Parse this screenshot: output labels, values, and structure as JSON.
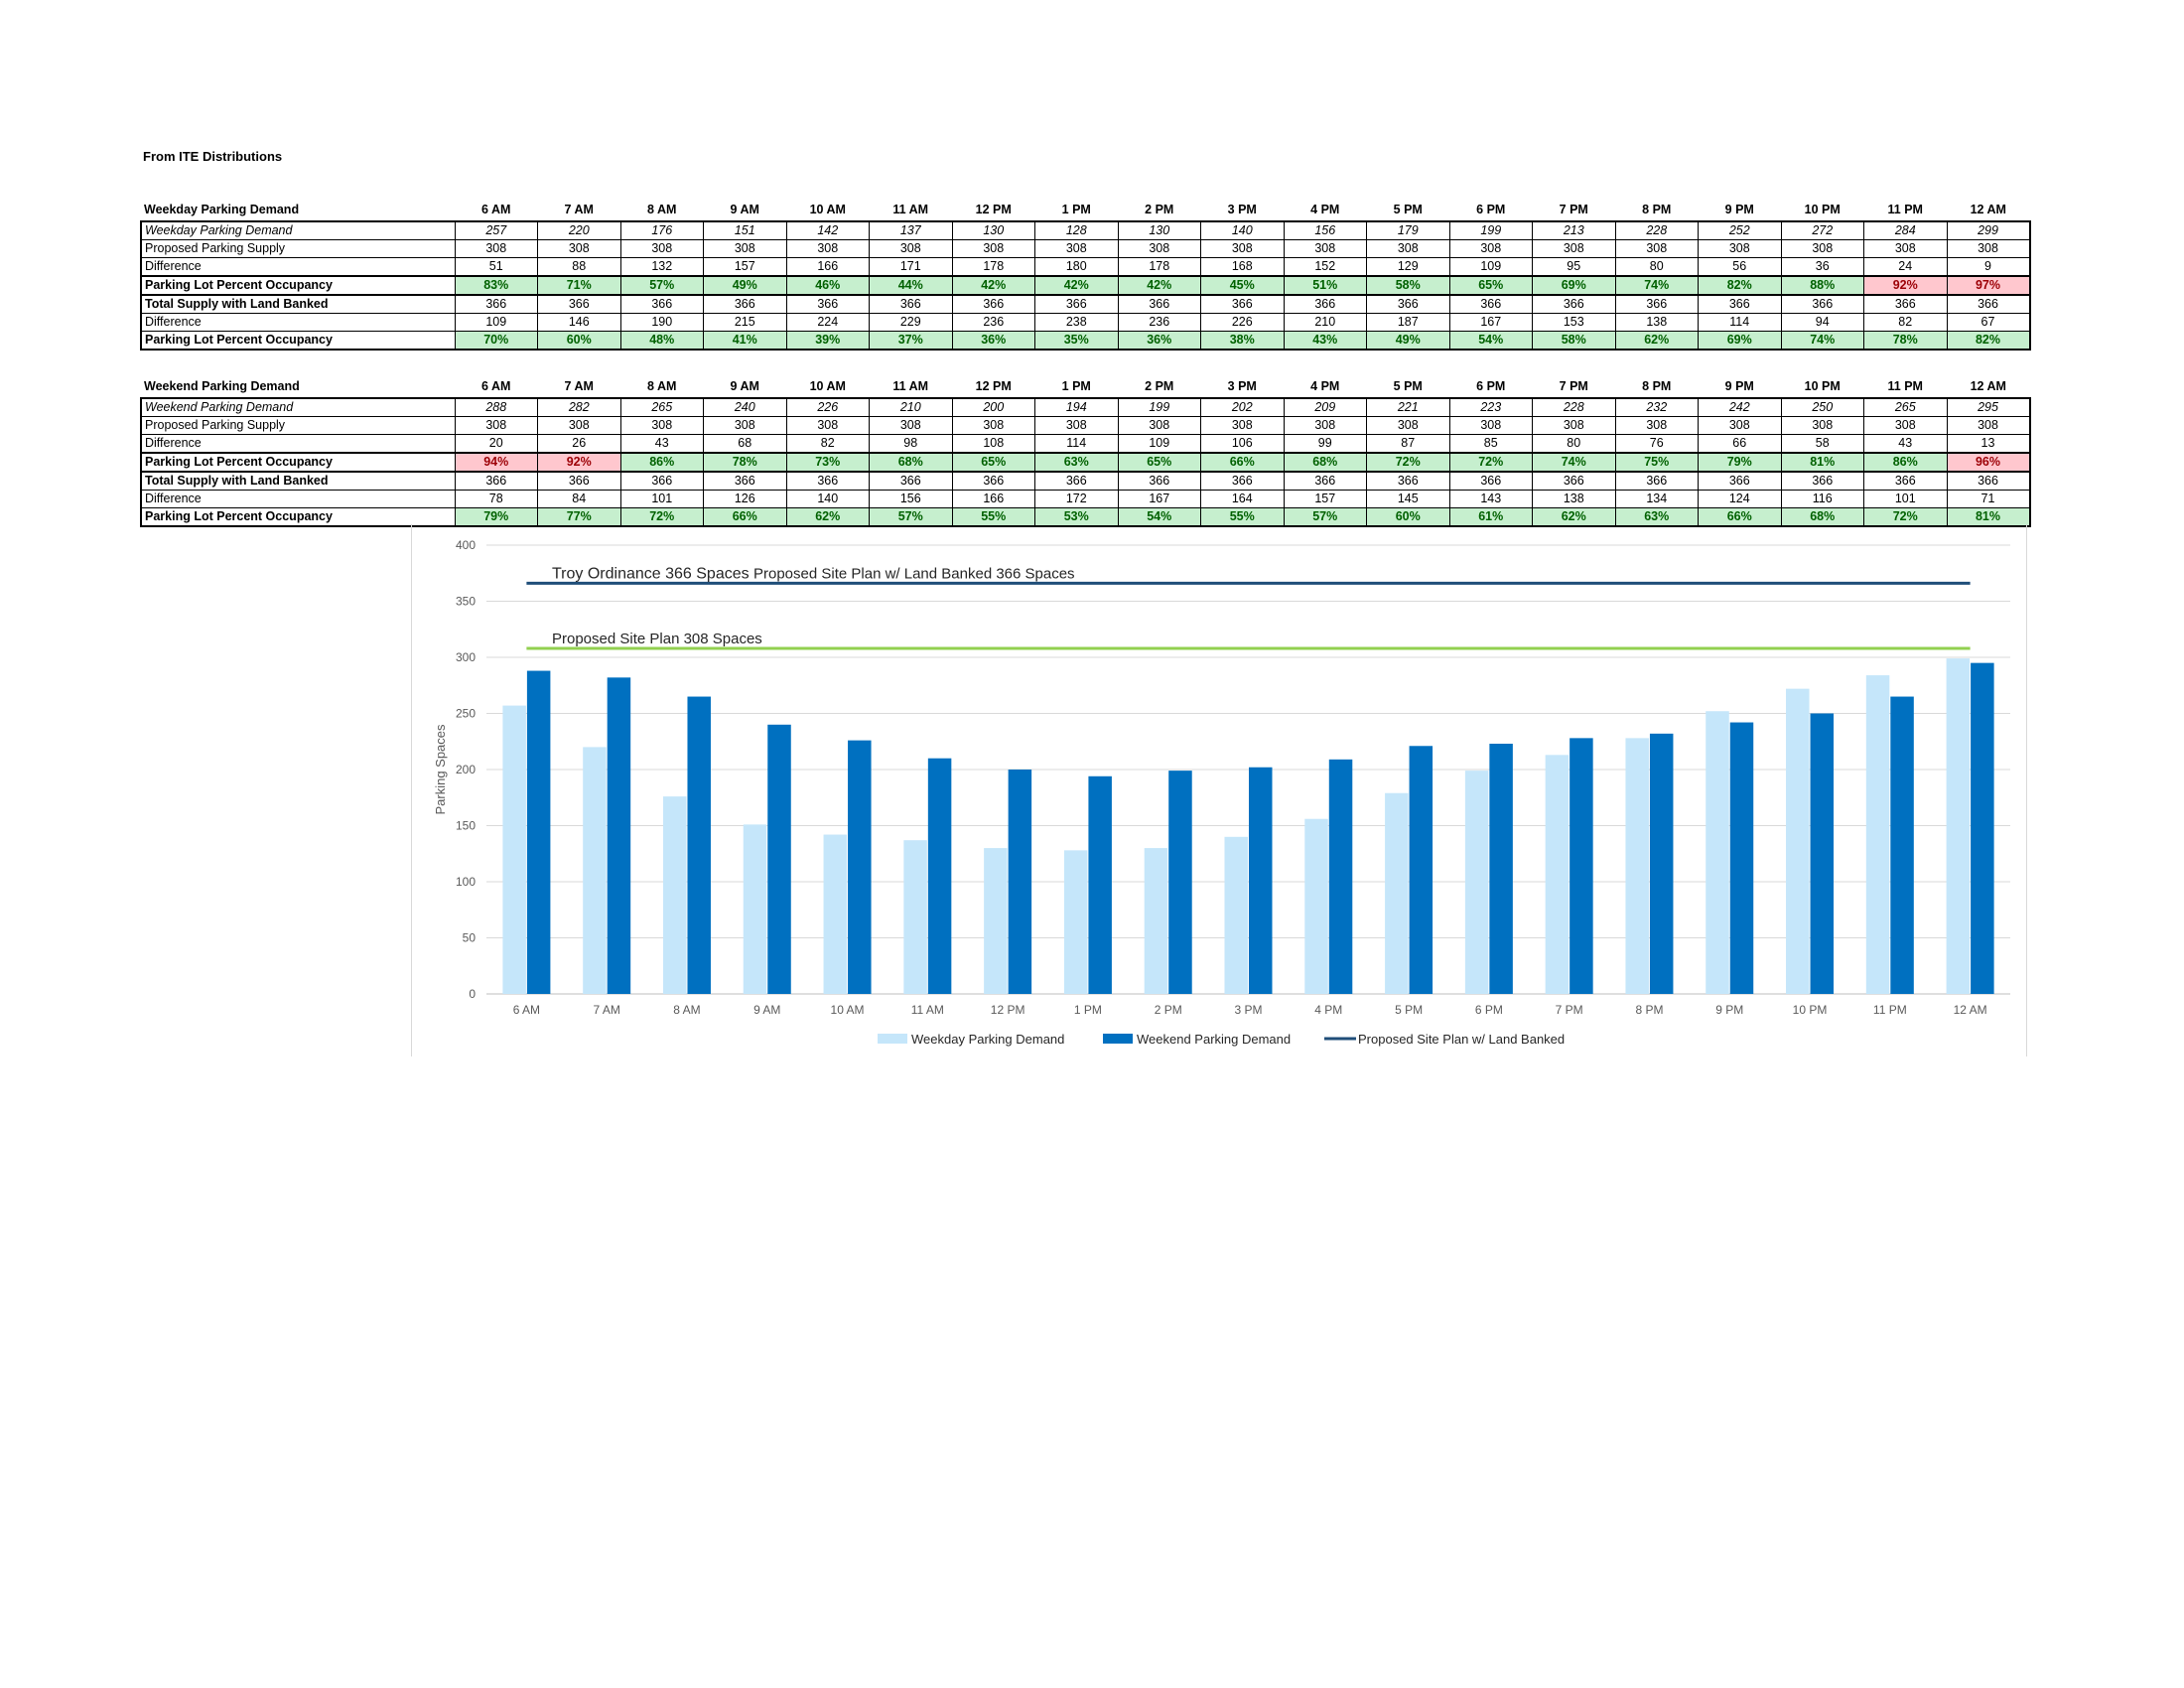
{
  "source_title": "From ITE Distributions",
  "tables": [
    {
      "header": "Weekday Parking Demand",
      "hours": [
        "6 AM",
        "7 AM",
        "8 AM",
        "9 AM",
        "10 AM",
        "11 AM",
        "12 PM",
        "1 PM",
        "2 PM",
        "3 PM",
        "4 PM",
        "5 PM",
        "6 PM",
        "7 PM",
        "8 PM",
        "9 PM",
        "10 PM",
        "11 PM",
        "12 AM"
      ],
      "rows": [
        {
          "label": "Weekday Parking Demand",
          "values": [
            "257",
            "220",
            "176",
            "151",
            "142",
            "137",
            "130",
            "128",
            "130",
            "140",
            "156",
            "179",
            "199",
            "213",
            "228",
            "252",
            "272",
            "284",
            "299"
          ]
        },
        {
          "label": "Proposed Parking Supply",
          "values": [
            "308",
            "308",
            "308",
            "308",
            "308",
            "308",
            "308",
            "308",
            "308",
            "308",
            "308",
            "308",
            "308",
            "308",
            "308",
            "308",
            "308",
            "308",
            "308"
          ]
        },
        {
          "label": " Difference",
          "values": [
            "51",
            "88",
            "132",
            "157",
            "166",
            "171",
            "178",
            "180",
            "178",
            "168",
            "152",
            "129",
            "109",
            "95",
            "80",
            "56",
            "36",
            "24",
            "9"
          ]
        },
        {
          "label": "Parking Lot Percent Occupancy",
          "values": [
            "83%",
            "71%",
            "57%",
            "49%",
            "46%",
            "44%",
            "42%",
            "42%",
            "42%",
            "45%",
            "51%",
            "58%",
            "65%",
            "69%",
            "74%",
            "82%",
            "88%",
            "92%",
            "97%"
          ],
          "status": [
            "ok",
            "ok",
            "ok",
            "ok",
            "ok",
            "ok",
            "ok",
            "ok",
            "ok",
            "ok",
            "ok",
            "ok",
            "ok",
            "ok",
            "ok",
            "ok",
            "ok",
            "over",
            "over"
          ]
        },
        {
          "label": "Total Supply with Land Banked",
          "values": [
            "366",
            "366",
            "366",
            "366",
            "366",
            "366",
            "366",
            "366",
            "366",
            "366",
            "366",
            "366",
            "366",
            "366",
            "366",
            "366",
            "366",
            "366",
            "366"
          ]
        },
        {
          "label": " Difference",
          "values": [
            "109",
            "146",
            "190",
            "215",
            "224",
            "229",
            "236",
            "238",
            "236",
            "226",
            "210",
            "187",
            "167",
            "153",
            "138",
            "114",
            "94",
            "82",
            "67"
          ]
        },
        {
          "label": "Parking Lot Percent Occupancy",
          "values": [
            "70%",
            "60%",
            "48%",
            "41%",
            "39%",
            "37%",
            "36%",
            "35%",
            "36%",
            "38%",
            "43%",
            "49%",
            "54%",
            "58%",
            "62%",
            "69%",
            "74%",
            "78%",
            "82%"
          ],
          "status": [
            "ok",
            "ok",
            "ok",
            "ok",
            "ok",
            "ok",
            "ok",
            "ok",
            "ok",
            "ok",
            "ok",
            "ok",
            "ok",
            "ok",
            "ok",
            "ok",
            "ok",
            "ok",
            "ok"
          ]
        }
      ]
    },
    {
      "header": "Weekend Parking Demand",
      "hours": [
        "6 AM",
        "7 AM",
        "8 AM",
        "9 AM",
        "10 AM",
        "11 AM",
        "12 PM",
        "1 PM",
        "2 PM",
        "3 PM",
        "4 PM",
        "5 PM",
        "6 PM",
        "7 PM",
        "8 PM",
        "9 PM",
        "10 PM",
        "11 PM",
        "12 AM"
      ],
      "rows": [
        {
          "label": "Weekend Parking Demand",
          "values": [
            "288",
            "282",
            "265",
            "240",
            "226",
            "210",
            "200",
            "194",
            "199",
            "202",
            "209",
            "221",
            "223",
            "228",
            "232",
            "242",
            "250",
            "265",
            "295"
          ]
        },
        {
          "label": "Proposed Parking Supply",
          "values": [
            "308",
            "308",
            "308",
            "308",
            "308",
            "308",
            "308",
            "308",
            "308",
            "308",
            "308",
            "308",
            "308",
            "308",
            "308",
            "308",
            "308",
            "308",
            "308"
          ]
        },
        {
          "label": " Difference",
          "values": [
            "20",
            "26",
            "43",
            "68",
            "82",
            "98",
            "108",
            "114",
            "109",
            "106",
            "99",
            "87",
            "85",
            "80",
            "76",
            "66",
            "58",
            "43",
            "13"
          ]
        },
        {
          "label": "Parking Lot Percent Occupancy",
          "values": [
            "94%",
            "92%",
            "86%",
            "78%",
            "73%",
            "68%",
            "65%",
            "63%",
            "65%",
            "66%",
            "68%",
            "72%",
            "72%",
            "74%",
            "75%",
            "79%",
            "81%",
            "86%",
            "96%"
          ],
          "status": [
            "over",
            "over",
            "ok",
            "ok",
            "ok",
            "ok",
            "ok",
            "ok",
            "ok",
            "ok",
            "ok",
            "ok",
            "ok",
            "ok",
            "ok",
            "ok",
            "ok",
            "ok",
            "over"
          ]
        },
        {
          "label": "Total Supply with Land Banked",
          "values": [
            "366",
            "366",
            "366",
            "366",
            "366",
            "366",
            "366",
            "366",
            "366",
            "366",
            "366",
            "366",
            "366",
            "366",
            "366",
            "366",
            "366",
            "366",
            "366"
          ]
        },
        {
          "label": " Difference",
          "values": [
            "78",
            "84",
            "101",
            "126",
            "140",
            "156",
            "166",
            "172",
            "167",
            "164",
            "157",
            "145",
            "143",
            "138",
            "134",
            "124",
            "116",
            "101",
            "71"
          ]
        },
        {
          "label": "Parking Lot Percent Occupancy",
          "values": [
            "79%",
            "77%",
            "72%",
            "66%",
            "62%",
            "57%",
            "55%",
            "53%",
            "54%",
            "55%",
            "57%",
            "60%",
            "61%",
            "62%",
            "63%",
            "66%",
            "68%",
            "72%",
            "81%"
          ],
          "status": [
            "ok",
            "ok",
            "ok",
            "ok",
            "ok",
            "ok",
            "ok",
            "ok",
            "ok",
            "ok",
            "ok",
            "ok",
            "ok",
            "ok",
            "ok",
            "ok",
            "ok",
            "ok",
            "ok"
          ]
        }
      ]
    }
  ],
  "chart_data": {
    "type": "bar",
    "categories": [
      "6 AM",
      "7 AM",
      "8 AM",
      "9 AM",
      "10 AM",
      "11 AM",
      "12 PM",
      "1 PM",
      "2 PM",
      "3 PM",
      "4 PM",
      "5 PM",
      "6 PM",
      "7 PM",
      "8 PM",
      "9 PM",
      "10 PM",
      "11 PM",
      "12 AM"
    ],
    "series": [
      {
        "name": "Weekday Parking Demand",
        "values": [
          257,
          220,
          176,
          151,
          142,
          137,
          130,
          128,
          130,
          140,
          156,
          179,
          199,
          213,
          228,
          252,
          272,
          284,
          299
        ],
        "color": "#c5e6fa"
      },
      {
        "name": "Weekend Parking Demand",
        "values": [
          288,
          282,
          265,
          240,
          226,
          210,
          200,
          194,
          199,
          202,
          209,
          221,
          223,
          228,
          232,
          242,
          250,
          265,
          295
        ],
        "color": "#0070c0"
      }
    ],
    "lines": [
      {
        "name": "Proposed Site Plan w/ Land Banked",
        "value": 366,
        "color": "#1f4e79"
      },
      {
        "name": "",
        "value": 308,
        "color": "#92d050"
      }
    ],
    "annotations": [
      {
        "text": "Troy Ordinance 366 Spaces",
        "value": 366
      },
      {
        "text": "Proposed Site Plan w/ Land Banked 366 Spaces",
        "value": 366
      },
      {
        "text": "Proposed Site Plan 308 Spaces",
        "value": 308
      }
    ],
    "ylabel": "Parking Spaces",
    "xlabel": "",
    "ylim": [
      0,
      400
    ],
    "yticks": [
      0,
      50,
      100,
      150,
      200,
      250,
      300,
      350,
      400
    ],
    "grid": true,
    "legend": "bottom",
    "legend_entries": [
      "Weekday Parking Demand",
      "Weekend Parking Demand",
      "Proposed Site Plan w/ Land Banked"
    ],
    "colors": {
      "ok_bg": "#c6efce",
      "ok_text": "#006100",
      "over_bg": "#ffc7ce",
      "over_text": "#9c0006"
    }
  }
}
